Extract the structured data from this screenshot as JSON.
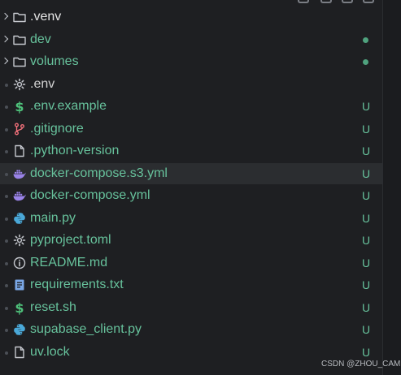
{
  "explorer": {
    "items": [
      {
        "label": ".venv",
        "type": "folder",
        "icon": "folder-icon",
        "label_color": "#e6e6e6",
        "status": "",
        "chevron": true,
        "decoration": ""
      },
      {
        "label": "dev",
        "type": "folder",
        "icon": "folder-icon",
        "label_color": "#67c29c",
        "status": "",
        "chevron": true,
        "decoration": "dot"
      },
      {
        "label": "volumes",
        "type": "folder",
        "icon": "folder-icon",
        "label_color": "#67c29c",
        "status": "",
        "chevron": true,
        "decoration": "dot"
      },
      {
        "label": ".env",
        "type": "file",
        "icon": "gear-icon",
        "label_color": "#d4d4d4",
        "status": "",
        "chevron": false,
        "decoration": ""
      },
      {
        "label": ".env.example",
        "type": "file",
        "icon": "dollar-icon",
        "label_color": "#67c29c",
        "status": "U",
        "chevron": false,
        "decoration": ""
      },
      {
        "label": ".gitignore",
        "type": "file",
        "icon": "git-branch-icon",
        "label_color": "#67c29c",
        "status": "U",
        "chevron": false,
        "decoration": ""
      },
      {
        "label": ".python-version",
        "type": "file",
        "icon": "file-icon",
        "label_color": "#67c29c",
        "status": "U",
        "chevron": false,
        "decoration": ""
      },
      {
        "label": "docker-compose.s3.yml",
        "type": "file",
        "icon": "docker-icon",
        "label_color": "#67c29c",
        "status": "U",
        "chevron": false,
        "decoration": ""
      },
      {
        "label": "docker-compose.yml",
        "type": "file",
        "icon": "docker-icon",
        "label_color": "#67c29c",
        "status": "U",
        "chevron": false,
        "decoration": ""
      },
      {
        "label": "main.py",
        "type": "file",
        "icon": "python-icon",
        "label_color": "#67c29c",
        "status": "U",
        "chevron": false,
        "decoration": ""
      },
      {
        "label": "pyproject.toml",
        "type": "file",
        "icon": "gear-icon",
        "label_color": "#67c29c",
        "status": "U",
        "chevron": false,
        "decoration": ""
      },
      {
        "label": "README.md",
        "type": "file",
        "icon": "info-icon",
        "label_color": "#67c29c",
        "status": "U",
        "chevron": false,
        "decoration": ""
      },
      {
        "label": "requirements.txt",
        "type": "file",
        "icon": "text-file-icon",
        "label_color": "#67c29c",
        "status": "U",
        "chevron": false,
        "decoration": ""
      },
      {
        "label": "reset.sh",
        "type": "file",
        "icon": "dollar-icon",
        "label_color": "#67c29c",
        "status": "U",
        "chevron": false,
        "decoration": ""
      },
      {
        "label": "supabase_client.py",
        "type": "file",
        "icon": "python-icon",
        "label_color": "#67c29c",
        "status": "U",
        "chevron": false,
        "decoration": ""
      },
      {
        "label": "uv.lock",
        "type": "file",
        "icon": "file-icon",
        "label_color": "#67c29c",
        "status": "U",
        "chevron": false,
        "decoration": ""
      }
    ],
    "selected_index": 7
  },
  "watermark": "CSDN @ZHOU_CAMP",
  "colors": {
    "background": "#1e1f22",
    "selection": "#2b2d30",
    "untracked": "#67c29c",
    "modified_dot": "#4fa27e"
  }
}
